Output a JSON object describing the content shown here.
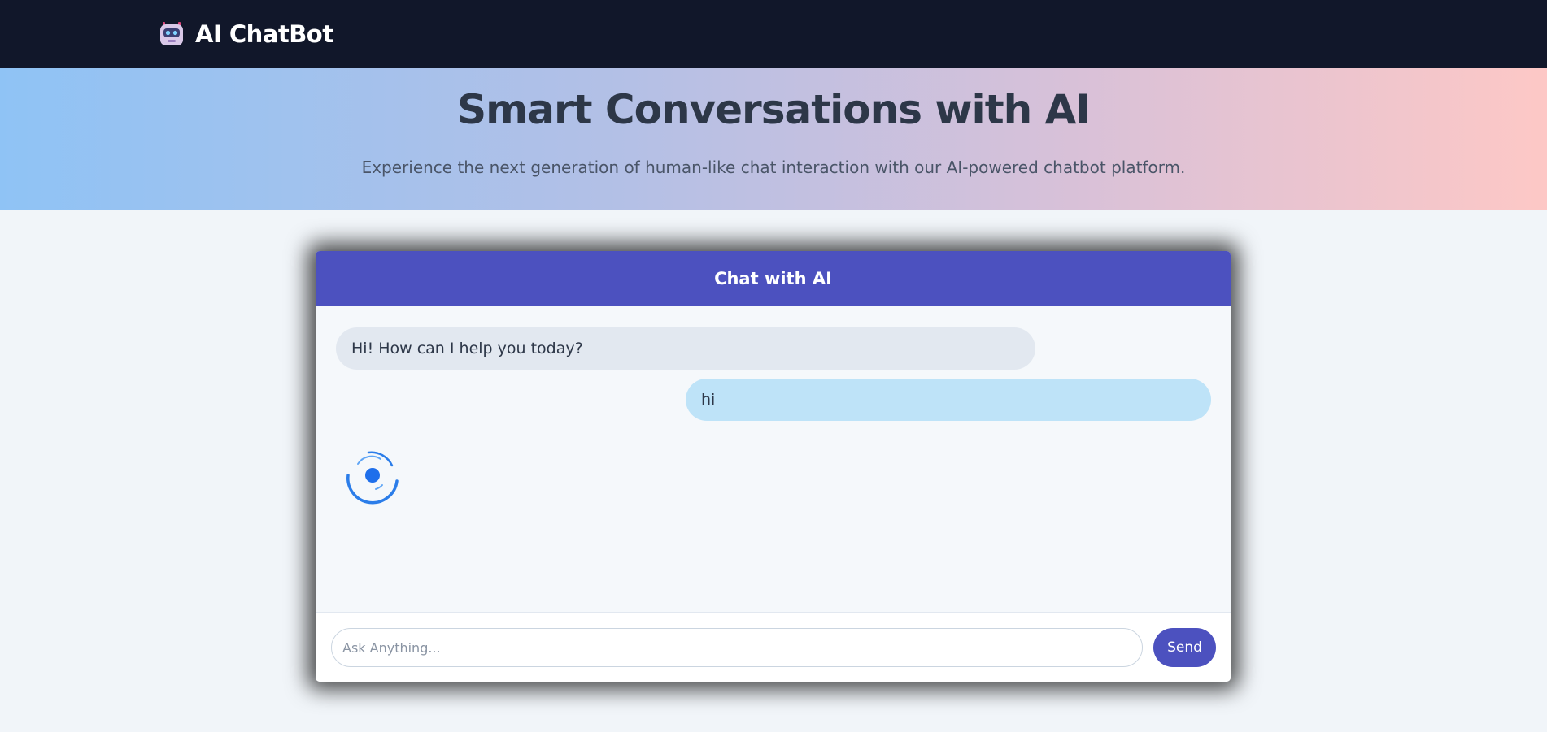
{
  "navbar": {
    "brand": "AI ChatBot",
    "logo_icon": "robot-icon"
  },
  "hero": {
    "title": "Smart Conversations with AI",
    "subtitle": "Experience the next generation of human-like chat interaction with our AI-powered chatbot platform."
  },
  "chat": {
    "header": "Chat with AI",
    "messages": [
      {
        "sender": "bot",
        "text": "Hi! How can I help you today?"
      },
      {
        "sender": "user",
        "text": "hi"
      }
    ],
    "loading_icon": "loading-spinner-icon",
    "input_placeholder": "Ask Anything...",
    "input_value": "",
    "send_label": "Send"
  },
  "colors": {
    "navbar_bg": "#11172a",
    "accent": "#4c51bf",
    "bot_bubble": "#e2e8f0",
    "user_bubble": "#bee3f8",
    "spinner": "#2b7de9"
  }
}
